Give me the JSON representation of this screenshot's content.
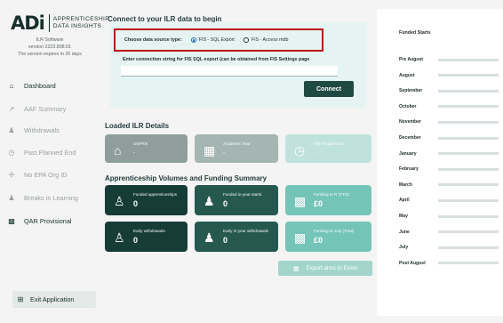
{
  "sidebar": {
    "logo_mark": "ADi",
    "logo_line1": "APPRENTICESHIP",
    "logo_line2": "DATA INSIGHTS",
    "software_name": "ILR Software",
    "version": "version 2223.808.01",
    "expiry": "The version expires in 26 days",
    "items": [
      {
        "label": "Dashboard",
        "icon": "home-icon"
      },
      {
        "label": "AAF Summary",
        "icon": "chart-icon"
      },
      {
        "label": "Withdrawals",
        "icon": "user-minus-icon"
      },
      {
        "label": "Past Planned End",
        "icon": "clock-icon"
      },
      {
        "label": "No EPA Org ID",
        "icon": "no-entry-icon"
      },
      {
        "label": "Breaks in Learning",
        "icon": "user-pause-icon"
      },
      {
        "label": "QAR Provisional",
        "icon": "bar-chart-icon"
      }
    ],
    "exit_label": "Exit Application"
  },
  "connect": {
    "title": "Connect to your ILR data to begin",
    "source_label": "Choose data source type:",
    "option_sql": "FIS - SQL Export",
    "option_mdb": "FIS - Access mdb",
    "selected": "sql",
    "conn_label": "Enter connection string for FIS SQL export (can be obtained from FIS Settings page",
    "conn_value": "",
    "connect_button": "Connect"
  },
  "loaded": {
    "title": "Loaded ILR Details",
    "cards": [
      {
        "title": "UKPRN",
        "value": "-",
        "color": "#909e9b"
      },
      {
        "title": "Academic Year",
        "value": "-",
        "color": "#a5b5b2"
      },
      {
        "title": "File Prepared on",
        "value": "-",
        "color": "#bfe2dc"
      }
    ]
  },
  "volumes": {
    "title": "Apprenticeship Volumes and Funding Summary",
    "cards": [
      {
        "title": "Funded apprenticeships",
        "value": "0",
        "color": "#173c37",
        "icon": "group-icon"
      },
      {
        "title": "Funded in-year starts",
        "value": "0",
        "color": "#25594f",
        "icon": "user-plus-icon"
      },
      {
        "title": "Funding to R (YTD)",
        "value": "£0",
        "color": "#75c4b8",
        "icon": "money-icon"
      },
      {
        "title": "Early withdrawals",
        "value": "0",
        "color": "#173c37",
        "icon": "group-icon"
      },
      {
        "title": "Early in-year withdrawals",
        "value": "0",
        "color": "#25594f",
        "icon": "user-minus-icon"
      },
      {
        "title": "Funding to July (Total)",
        "value": "£0",
        "color": "#75c4b8",
        "icon": "money-icon"
      }
    ],
    "export_button": "Export aims to Excel"
  },
  "funded_starts": {
    "title": "Funded Starts",
    "rows": [
      {
        "month": "Pre August",
        "value": "0"
      },
      {
        "month": "August",
        "value": "0"
      },
      {
        "month": "September",
        "value": "0"
      },
      {
        "month": "October",
        "value": "0"
      },
      {
        "month": "November",
        "value": "0"
      },
      {
        "month": "December",
        "value": "0"
      },
      {
        "month": "January",
        "value": "0"
      },
      {
        "month": "February",
        "value": "0"
      },
      {
        "month": "March",
        "value": "0"
      },
      {
        "month": "April",
        "value": "0"
      },
      {
        "month": "May",
        "value": "0"
      },
      {
        "month": "June",
        "value": "0"
      },
      {
        "month": "July",
        "value": "0"
      },
      {
        "month": "Post August",
        "value": "0"
      }
    ]
  }
}
